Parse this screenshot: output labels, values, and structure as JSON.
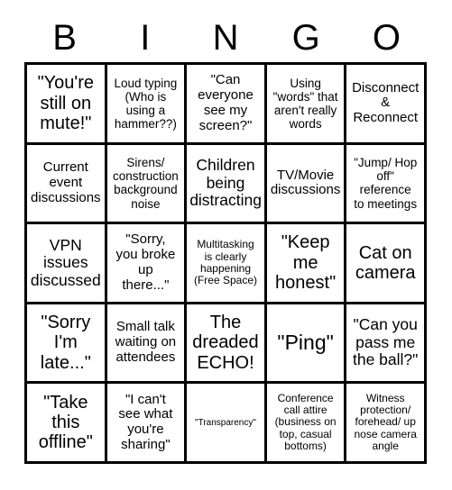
{
  "card": {
    "title": "BINGO",
    "header_letters": [
      "B",
      "I",
      "N",
      "G",
      "O"
    ],
    "rows": 5,
    "columns": 5,
    "free_space_index": 12,
    "colors": {
      "background": "#ffffff",
      "border": "#000000",
      "text": "#000000"
    },
    "cells": [
      {
        "text": "\"You're\nstill on\nmute!\"",
        "size": "fs-xl"
      },
      {
        "text": "Loud typing\n(Who is\nusing a\nhammer??)",
        "size": "fs-sm"
      },
      {
        "text": "\"Can\neveryone\nsee my\nscreen?\"",
        "size": "fs-md"
      },
      {
        "text": "Using\n\"words\" that\naren't really\nwords",
        "size": "fs-sm"
      },
      {
        "text": "Disconnect\n&\nReconnect",
        "size": "fs-md"
      },
      {
        "text": "Current\nevent\ndiscussions",
        "size": "fs-md"
      },
      {
        "text": "Sirens/\nconstruction\nbackground\nnoise",
        "size": "fs-sm"
      },
      {
        "text": "Children\nbeing\ndistracting",
        "size": "fs-lg"
      },
      {
        "text": "TV/Movie\ndiscussions",
        "size": "fs-md"
      },
      {
        "text": "\"Jump/ Hop\noff\"\nreference\nto meetings",
        "size": "fs-sm"
      },
      {
        "text": "VPN\nissues\ndiscussed",
        "size": "fs-lg"
      },
      {
        "text": "\"Sorry,\nyou broke\nup\nthere...\"",
        "size": "fs-md"
      },
      {
        "text": "Multitasking\nis clearly\nhappening\n(Free Space)",
        "size": "fs-xs"
      },
      {
        "text": "\"Keep\nme\nhonest\"",
        "size": "fs-xl"
      },
      {
        "text": "Cat on\ncamera",
        "size": "fs-xl"
      },
      {
        "text": "\"Sorry\nI'm\nlate...\"",
        "size": "fs-xl"
      },
      {
        "text": "Small talk\nwaiting on\nattendees",
        "size": "fs-md"
      },
      {
        "text": "The\ndreaded\nECHO!",
        "size": "fs-xl"
      },
      {
        "text": "\"Ping\"",
        "size": "fs-huge"
      },
      {
        "text": "\"Can you\npass me\nthe ball?\"",
        "size": "fs-lg"
      },
      {
        "text": "\"Take\nthis\noffline\"",
        "size": "fs-xl"
      },
      {
        "text": "\"I can't\nsee what\nyou're\nsharing\"",
        "size": "fs-md"
      },
      {
        "text": "\"Transparency\"",
        "size": "fs-xxs"
      },
      {
        "text": "Conference\ncall attire\n(business on\ntop, casual\nbottoms)",
        "size": "fs-xs"
      },
      {
        "text": "Witness\nprotection/\nforehead/ up\nnose camera\nangle",
        "size": "fs-xs"
      }
    ]
  }
}
